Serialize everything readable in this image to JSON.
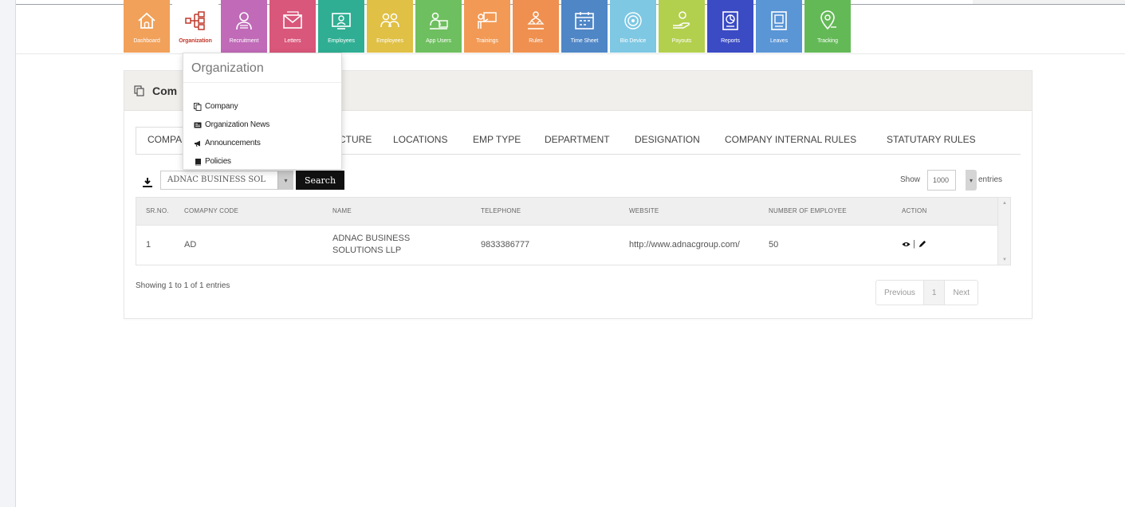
{
  "modules": [
    {
      "label": "Dashboard",
      "color": "#f1a15a",
      "icon": "home-icon"
    },
    {
      "label": "Organization",
      "color": "#ffffff",
      "icon": "org-chart-icon",
      "active": true
    },
    {
      "label": "Recruitment",
      "color": "#c06ab8",
      "icon": "recruitment-icon"
    },
    {
      "label": "Letters",
      "color": "#d9577a",
      "icon": "envelope-icon"
    },
    {
      "label": "Employees",
      "color": "#2fae93",
      "icon": "employees-icon"
    },
    {
      "label": "Employees",
      "color": "#e0c045",
      "icon": "employees-group-icon"
    },
    {
      "label": "App Users",
      "color": "#6ebf5f",
      "icon": "app-users-icon"
    },
    {
      "label": "Trainings",
      "color": "#f29a55",
      "icon": "training-icon"
    },
    {
      "label": "Rules",
      "color": "#ef9050",
      "icon": "rules-icon"
    },
    {
      "label": "Time Sheet",
      "color": "#4f86c6",
      "icon": "calendar-icon"
    },
    {
      "label": "Bio Device",
      "color": "#7ec8e3",
      "icon": "fingerprint-icon"
    },
    {
      "label": "Payouts",
      "color": "#b3cf4e",
      "icon": "payout-icon"
    },
    {
      "label": "Reports",
      "color": "#3b4bc4",
      "icon": "reports-icon"
    },
    {
      "label": "Leaves",
      "color": "#5a95d6",
      "icon": "leaves-icon"
    },
    {
      "label": "Tracking",
      "color": "#64b957",
      "icon": "location-pin-icon"
    }
  ],
  "panel": {
    "title": "Com"
  },
  "tabs": [
    {
      "label": "COMPA"
    },
    {
      "label": "CTURE"
    },
    {
      "label": "LOCATIONS"
    },
    {
      "label": "EMP TYPE"
    },
    {
      "label": "DEPARTMENT"
    },
    {
      "label": "DESIGNATION"
    },
    {
      "label": "COMPANY INTERNAL RULES"
    },
    {
      "label": "STATUTARY RULES"
    }
  ],
  "toolbar": {
    "company_value": "ADNAC BUSINESS SOL",
    "search_label": "Search",
    "show_label": "Show",
    "page_size": "1000",
    "entries_label": "entries"
  },
  "table": {
    "headers": [
      "SR.NO.",
      "COMAPNY CODE",
      "NAME",
      "TELEPHONE",
      "WEBSITE",
      "NUMBER OF EMPLOYEE",
      "ACTION"
    ],
    "rows": [
      {
        "sr": "1",
        "code": "AD",
        "name_line1": "ADNAC BUSINESS",
        "name_line2": "SOLUTIONS LLP",
        "telephone": "9833386777",
        "website": "http://www.adnacgroup.com/",
        "employees": "50",
        "action_sep": "|"
      }
    ]
  },
  "footer": {
    "showing": "Showing 1 to 1 of 1 entries",
    "previous": "Previous",
    "page": "1",
    "next": "Next"
  },
  "dropdown": {
    "title": "Organization",
    "items": [
      {
        "label": "Company",
        "icon": "copy-icon"
      },
      {
        "label": "Organization News",
        "icon": "newspaper-icon"
      },
      {
        "label": "Announcements",
        "icon": "megaphone-icon"
      },
      {
        "label": "Policies",
        "icon": "book-icon"
      }
    ]
  }
}
